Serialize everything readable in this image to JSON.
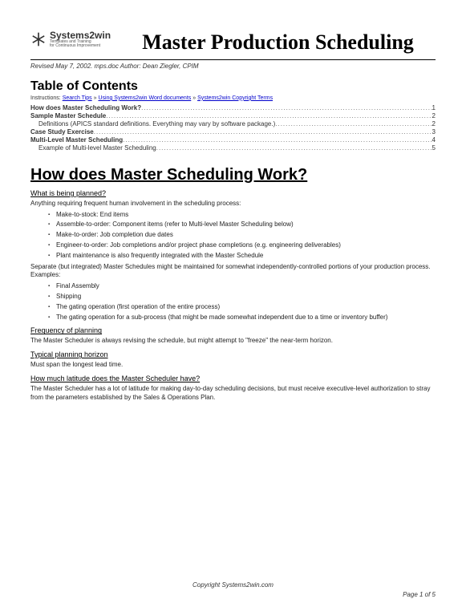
{
  "logo": {
    "name": "Systems2win",
    "tag1": "Templates and Training",
    "tag2": "for Continuous Improvement"
  },
  "title": "Master Production Scheduling",
  "revised": "Revised May 7, 2002. mps.doc  Author: Dean Ziegler, CPIM",
  "toc_heading": "Table of Contents",
  "instructions": {
    "prefix": "Instructions: ",
    "l1": "Search Tips",
    "sep": " » ",
    "l2": "Using Systems2win Word documents",
    "l3": "Systems2win Copyright Terms"
  },
  "toc": [
    {
      "label": "How does Master Scheduling Work?",
      "page": "1",
      "bold": true,
      "indent": false
    },
    {
      "label": "Sample Master Schedule",
      "page": "2",
      "bold": true,
      "indent": false
    },
    {
      "label": "Definitions (APICS standard definitions. Everything may vary by software package.)",
      "page": "2",
      "bold": false,
      "indent": true
    },
    {
      "label": "Case Study Exercise",
      "page": "3",
      "bold": true,
      "indent": false
    },
    {
      "label": "Multi-Level Master Scheduling",
      "page": "4",
      "bold": true,
      "indent": false
    },
    {
      "label": "Example of Multi-level Master Scheduling",
      "page": "5",
      "bold": false,
      "indent": true
    }
  ],
  "h1": "How does Master Scheduling Work?",
  "sec1": {
    "h": "What is being planned?",
    "p1": "Anything requiring frequent human involvement in the scheduling process:",
    "b1": [
      "Make-to-stock: End items",
      "Assemble-to-order: Component items (refer to Multi-level Master Scheduling below)",
      "Make-to-order: Job completion due dates",
      "Engineer-to-order: Job completions and/or project phase completions (e.g. engineering deliverables)",
      "Plant maintenance is also frequently integrated with the Master Schedule"
    ],
    "p2": "Separate (but integrated) Master Schedules might be maintained for somewhat independently-controlled portions of your production process. Examples:",
    "b2": [
      "Final Assembly",
      "Shipping",
      "The gating operation (first operation of the entire process)",
      "The gating operation for a sub-process (that might be made somewhat independent due to a time or inventory buffer)"
    ]
  },
  "sec2": {
    "h": "Frequency of planning",
    "p": "The Master Scheduler is always revising the schedule, but might attempt to \"freeze\" the near-term horizon."
  },
  "sec3": {
    "h": "Typical planning horizon",
    "p": "Must span the longest lead time."
  },
  "sec4": {
    "h": "How much latitude does the Master Scheduler have?",
    "p": "The Master Scheduler has a lot of latitude for making day-to-day scheduling decisions, but must receive executive-level authorization to stray from the parameters established by the Sales & Operations Plan."
  },
  "footer": "Copyright Systems2win.com",
  "page_num": "Page 1  of  5"
}
